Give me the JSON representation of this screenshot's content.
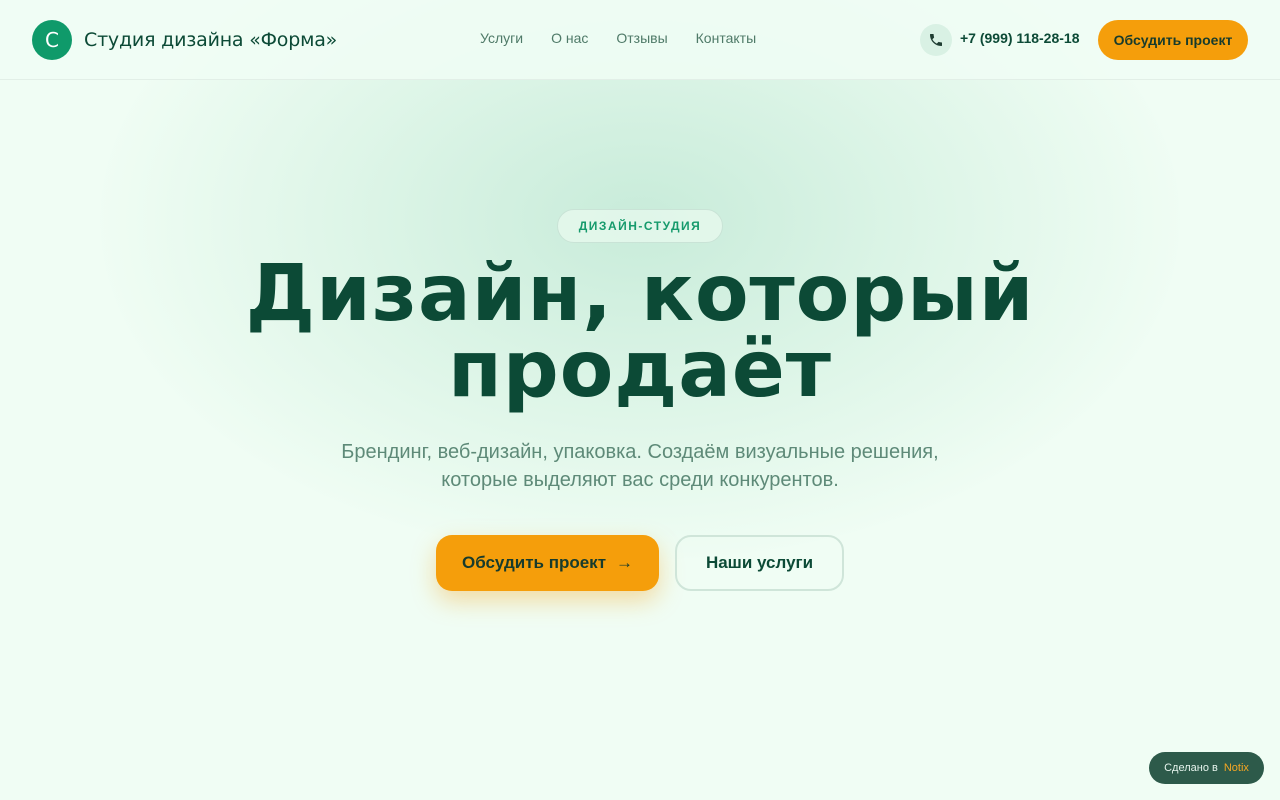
{
  "header": {
    "logo_letter": "С",
    "brand_name": "Студия дизайна «Форма»",
    "nav": [
      {
        "label": "Услуги"
      },
      {
        "label": "О нас"
      },
      {
        "label": "Отзывы"
      },
      {
        "label": "Контакты"
      }
    ],
    "phone_icon": "phone-icon",
    "phone": "+7 (999) 118-28-18",
    "cta_label": "Обсудить проект"
  },
  "hero": {
    "badge": "ДИЗАЙН-СТУДИЯ",
    "title_line1": "Дизайн, который",
    "title_line2": "продаёт",
    "subtitle_line1": "Брендинг, веб-дизайн, упаковка. Создаём визуальные решения,",
    "subtitle_line2": "которые выделяют вас среди конкурентов.",
    "primary_button": "Обсудить проект",
    "primary_arrow": "→",
    "secondary_button": "Наши услуги"
  },
  "made_with": {
    "prefix": "Сделано в",
    "brand": "Notix"
  },
  "colors": {
    "background": "#f0fdf4",
    "brand_green": "#0c4a36",
    "accent_green": "#0f9a6a",
    "accent_orange": "#f59e0b"
  }
}
